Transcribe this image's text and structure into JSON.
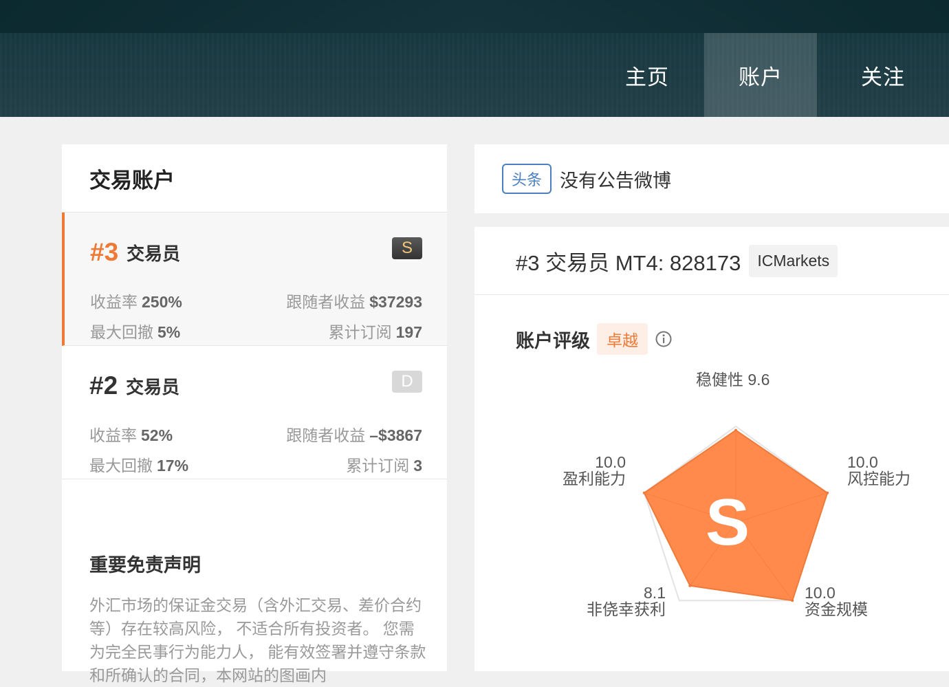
{
  "nav": {
    "items": [
      {
        "label": "主页"
      },
      {
        "label": "账户"
      },
      {
        "label": "关注"
      }
    ]
  },
  "left": {
    "title": "交易账户",
    "traders": [
      {
        "rank": "#3",
        "name": "交易员",
        "grade": "S",
        "return_label": "收益率",
        "return_value": "250%",
        "follower_label": "跟随者收益",
        "follower_value": "$37293",
        "drawdown_label": "最大回撤",
        "drawdown_value": "5%",
        "subs_label": "累计订阅",
        "subs_value": "197"
      },
      {
        "rank": "#2",
        "name": "交易员",
        "grade": "D",
        "return_label": "收益率",
        "return_value": "52%",
        "follower_label": "跟随者收益",
        "follower_value": "–$3867",
        "drawdown_label": "最大回撤",
        "drawdown_value": "17%",
        "subs_label": "累计订阅",
        "subs_value": "3"
      }
    ],
    "disclaimer_title": "重要免责声明",
    "disclaimer_text": "外汇市场的保证金交易（含外汇交易、差价合约等）存在较高风险， 不适合所有投资者。 您需为完全民事行为能力人， 能有效签署并遵守条款和所确认的合同，本网站的图画内"
  },
  "notice": {
    "tag": "头条",
    "text": "没有公告微博"
  },
  "account": {
    "title": "#3 交易员 MT4: 828173",
    "broker": "ICMarkets",
    "rating_label": "账户评级",
    "rating_level": "卓越",
    "grade": "S",
    "radar": {
      "max": 10,
      "axes": [
        {
          "name": "稳健性",
          "value": 9.6,
          "value_text": "9.6"
        },
        {
          "name": "风控能力",
          "value": 10.0,
          "value_text": "10.0"
        },
        {
          "name": "资金规模",
          "value": 10.0,
          "value_text": "10.0"
        },
        {
          "name": "非侥幸获利",
          "value": 8.1,
          "value_text": "8.1"
        },
        {
          "name": "盈利能力",
          "value": 10.0,
          "value_text": "10.0"
        }
      ],
      "fill_color": "#ff8a4c",
      "stroke_color": "#f07a3a"
    }
  }
}
